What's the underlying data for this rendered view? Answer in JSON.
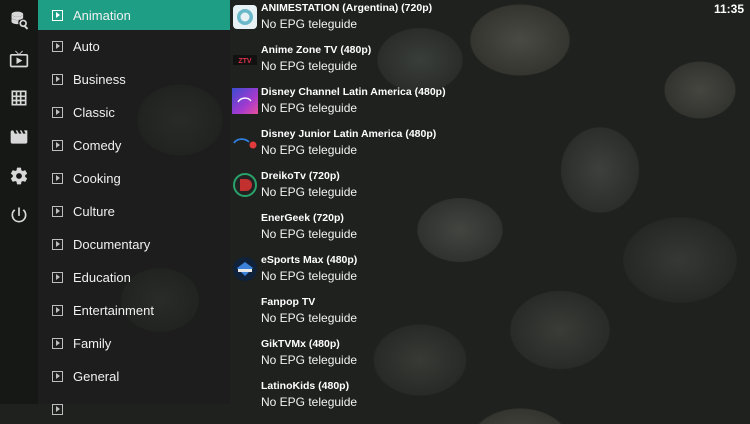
{
  "clock": "11:35",
  "rail": {
    "icons": [
      "search-icon",
      "tv-icon",
      "grid-icon",
      "movie-icon",
      "settings-icon",
      "power-icon"
    ]
  },
  "categories": {
    "selected": "Animation",
    "items": [
      {
        "label": "Animation"
      },
      {
        "label": "Auto"
      },
      {
        "label": "Business"
      },
      {
        "label": "Classic"
      },
      {
        "label": "Comedy"
      },
      {
        "label": "Cooking"
      },
      {
        "label": "Culture"
      },
      {
        "label": "Documentary"
      },
      {
        "label": "Education"
      },
      {
        "label": "Entertainment"
      },
      {
        "label": "Family"
      },
      {
        "label": "General"
      }
    ]
  },
  "channels": [
    {
      "name": "ANIMESTATION (Argentina) (720p)",
      "epg": "No EPG teleguide",
      "logo": "animestation-logo"
    },
    {
      "name": "Anime Zone TV (480p)",
      "epg": "No EPG teleguide",
      "logo": "anime-zone-logo",
      "logo_text": "ZTV"
    },
    {
      "name": "Disney Channel Latin America (480p)",
      "epg": "No EPG teleguide",
      "logo": "disney-channel-logo"
    },
    {
      "name": "Disney Junior Latin America (480p)",
      "epg": "No EPG teleguide",
      "logo": "disney-junior-logo"
    },
    {
      "name": "DreikoTv (720p)",
      "epg": "No EPG teleguide",
      "logo": "dreikotv-logo"
    },
    {
      "name": "EnerGeek (720p)",
      "epg": "No EPG teleguide",
      "logo": ""
    },
    {
      "name": "eSports Max (480p)",
      "epg": "No EPG teleguide",
      "logo": "esports-max-logo"
    },
    {
      "name": "Fanpop TV",
      "epg": "No EPG teleguide",
      "logo": ""
    },
    {
      "name": "GikTVMx (480p)",
      "epg": "No EPG teleguide",
      "logo": ""
    },
    {
      "name": "LatinoKids (480p)",
      "epg": "No EPG teleguide",
      "logo": ""
    }
  ],
  "colors": {
    "accent": "#1e9f85"
  }
}
